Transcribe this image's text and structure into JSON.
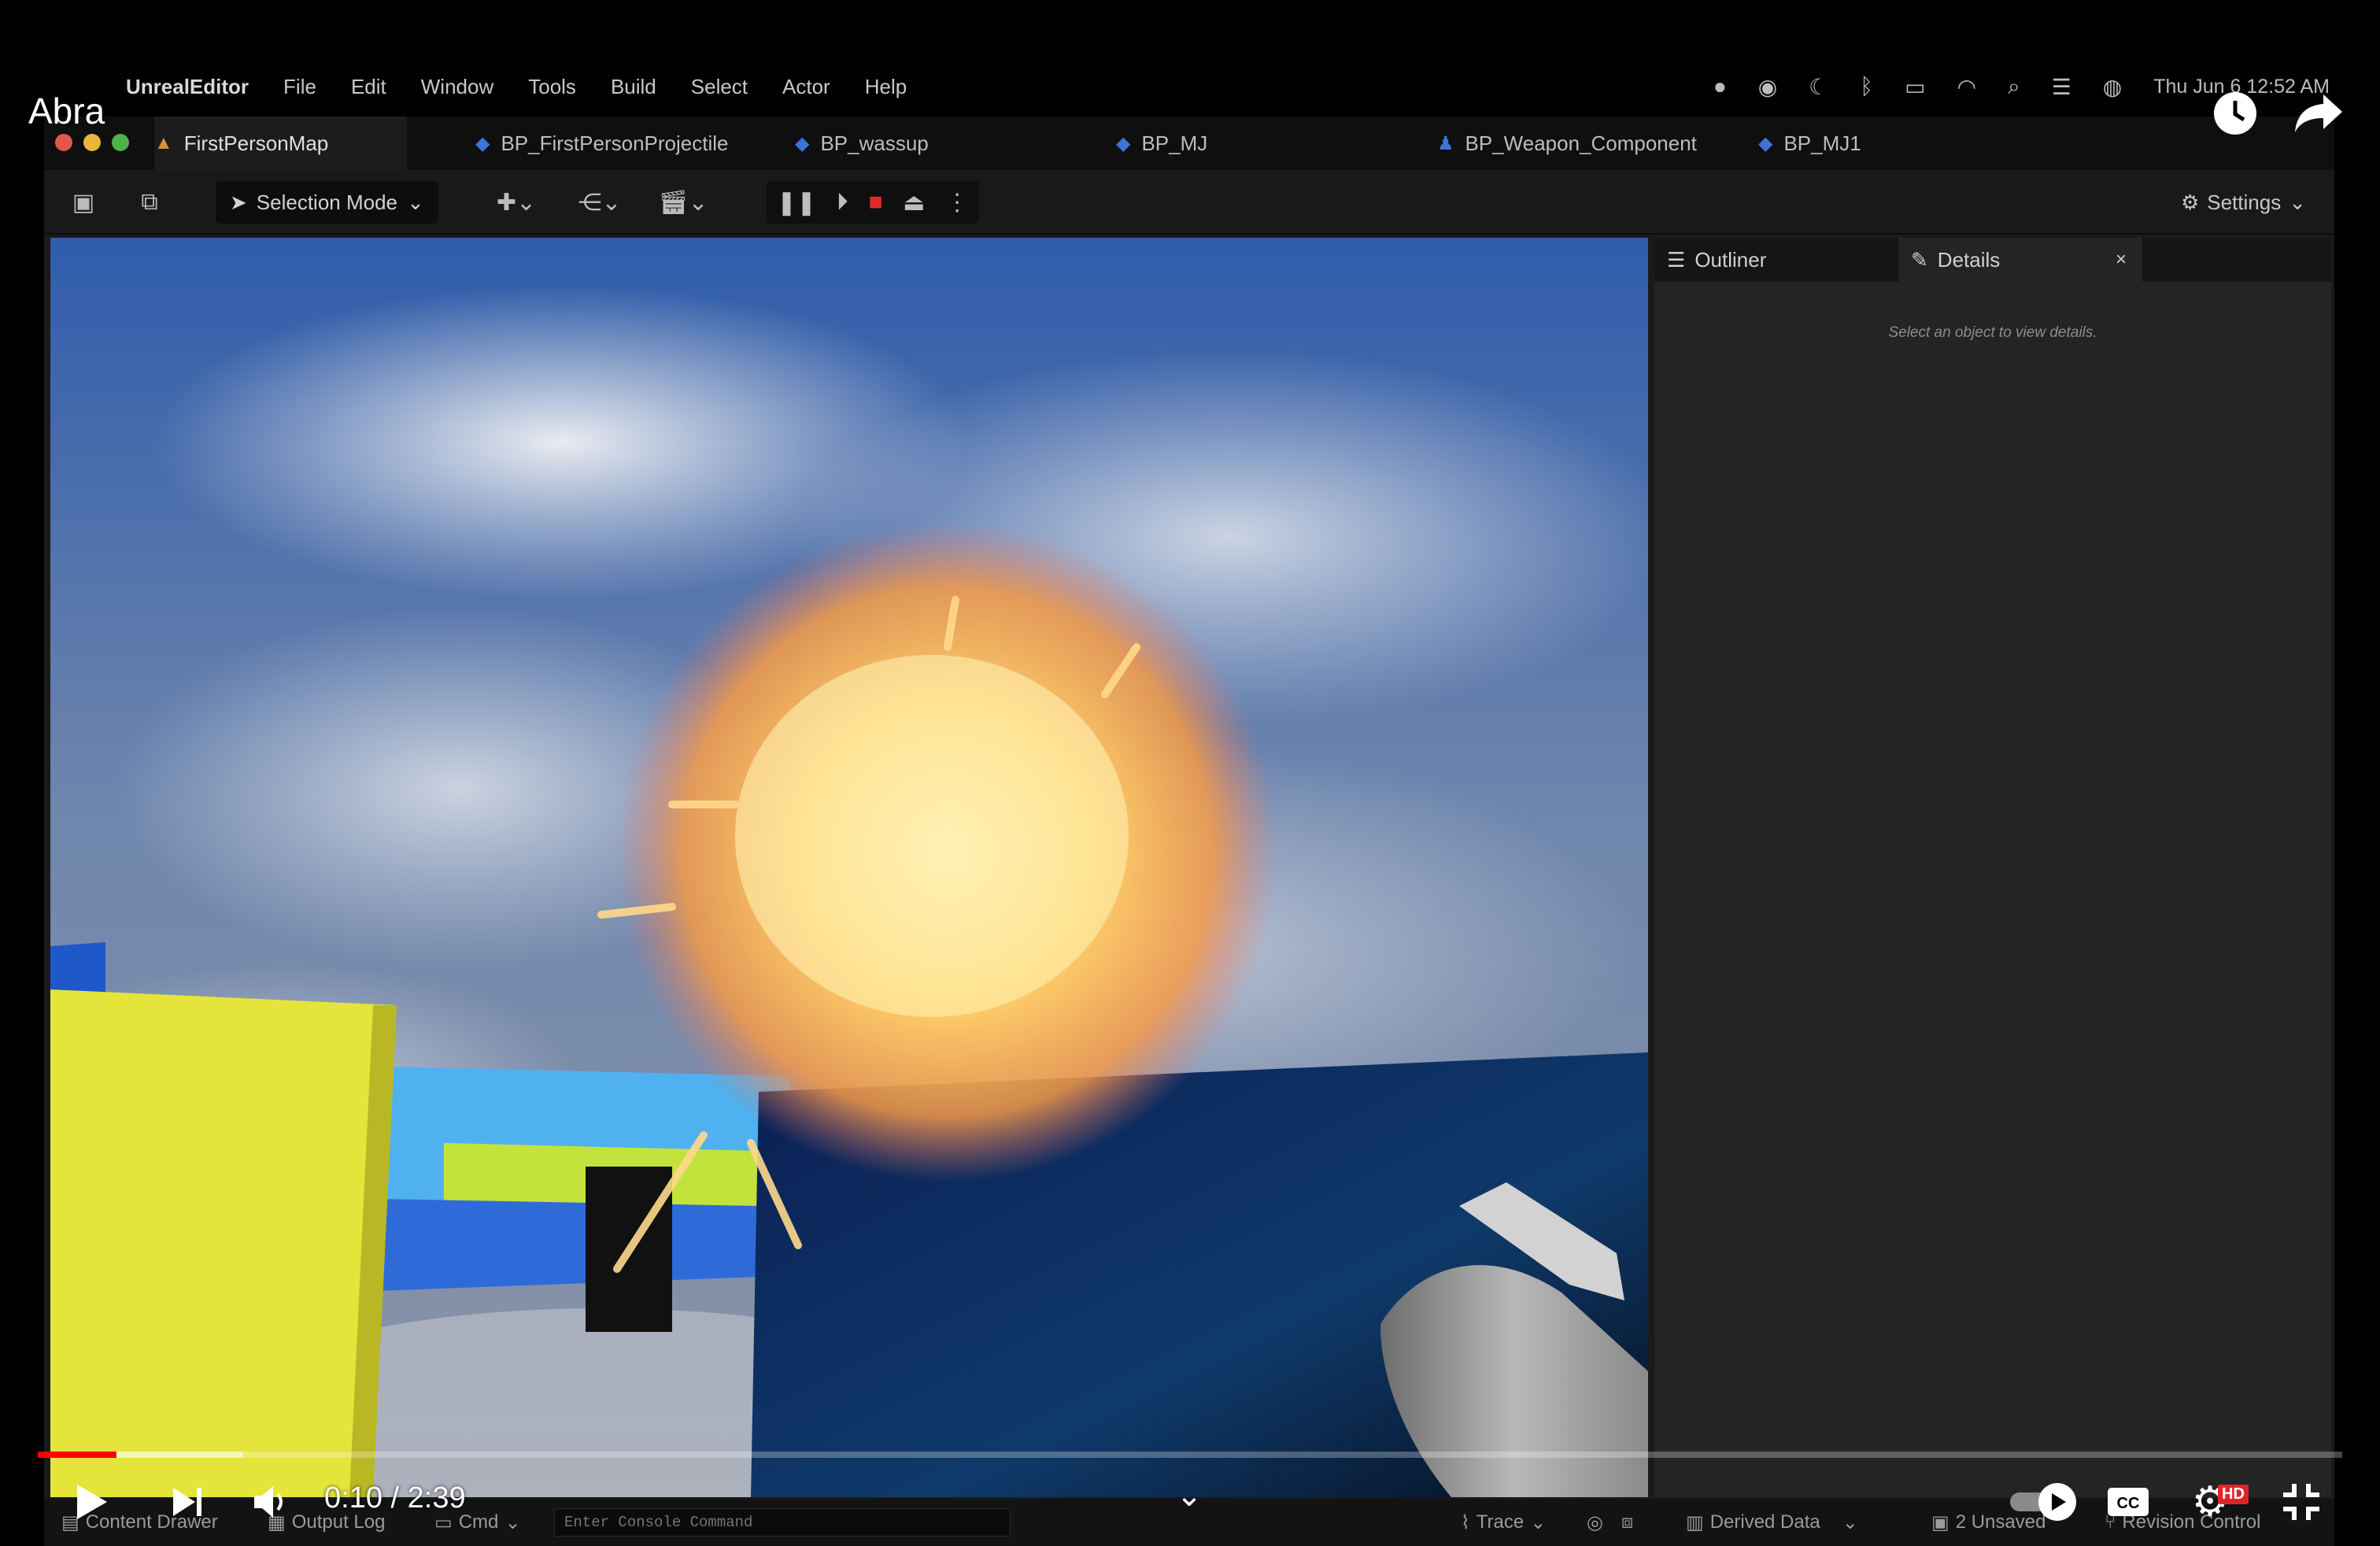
{
  "menubar": {
    "app_name": "UnrealEditor",
    "items": [
      "File",
      "Edit",
      "Window",
      "Tools",
      "Build",
      "Select",
      "Actor",
      "Help"
    ],
    "clock": "Thu Jun 6  12:52 AM"
  },
  "tabs": [
    {
      "label": "FirstPersonMap",
      "icon": "map-icon"
    },
    {
      "label": "BP_FirstPersonProjectile",
      "icon": "blueprint-icon"
    },
    {
      "label": "BP_wassup",
      "icon": "blueprint-icon"
    },
    {
      "label": "BP_MJ",
      "icon": "blueprint-icon"
    },
    {
      "label": "BP_Weapon_Component",
      "icon": "component-icon"
    },
    {
      "label": "BP_MJ1",
      "icon": "blueprint-icon"
    }
  ],
  "toolbar": {
    "selection_mode": "Selection Mode",
    "settings": "Settings"
  },
  "panel": {
    "outliner": "Outliner",
    "details": "Details",
    "details_empty": "Select an object to view details."
  },
  "statusbar": {
    "content_drawer": "Content Drawer",
    "output_log": "Output Log",
    "cmd": "Cmd",
    "console_placeholder": "Enter Console Command",
    "trace": "Trace",
    "derived_data": "Derived Data",
    "unsaved": "2 Unsaved",
    "revision_control": "Revision Control"
  },
  "video": {
    "channel": "Abra",
    "time": "0:10 / 2:39",
    "progress": 0.034,
    "buffered": 0.089,
    "quality_badge": "HD"
  },
  "colors": {
    "accent_red": "#ff0000",
    "blueprint_blue": "#3d74d6",
    "stop_red": "#e12b2b"
  }
}
